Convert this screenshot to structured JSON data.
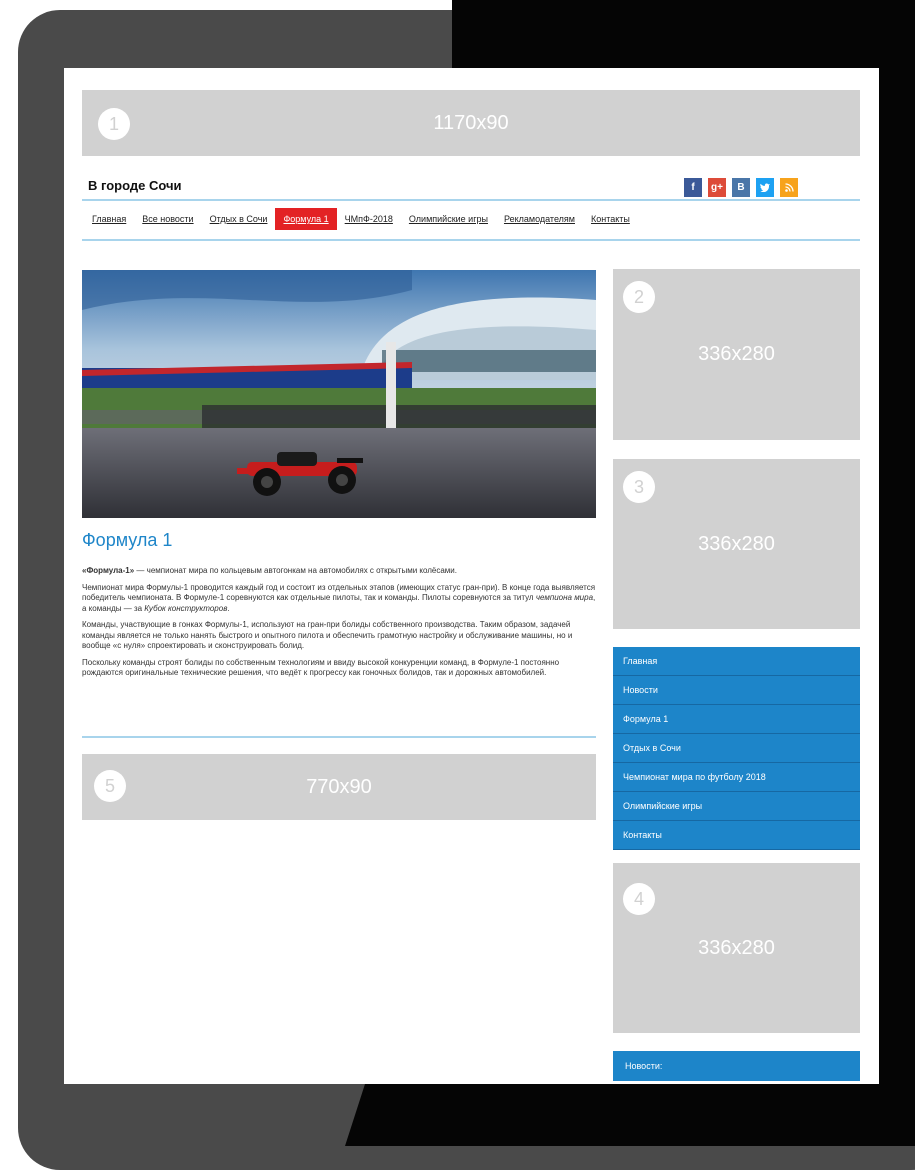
{
  "ads": {
    "top": {
      "num": "1",
      "size": "1170x90"
    },
    "side1": {
      "num": "2",
      "size": "336x280"
    },
    "side2": {
      "num": "3",
      "size": "336x280"
    },
    "side3": {
      "num": "4",
      "size": "336x280"
    },
    "bottom": {
      "num": "5",
      "size": "770x90"
    }
  },
  "header": {
    "title": "В городе Сочи",
    "social": [
      "f",
      "g+",
      "B",
      "t",
      "rss"
    ],
    "social_colors": [
      "#3b5998",
      "#dd4b39",
      "#4a76a8",
      "#1da1f2",
      "#f7a31c"
    ]
  },
  "nav": {
    "items": [
      "Главная",
      "Все новости",
      "Отдых в Сочи",
      "Формула 1",
      "ЧМпФ-2018",
      "Олимпийские игры",
      "Рекламодателям",
      "Контакты"
    ],
    "active_index": 3
  },
  "article": {
    "title": "Формула 1",
    "p1_bold": "«Формула-1»",
    "p1_rest": " — чемпионат мира по кольцевым автогонкам на автомобилях с открытыми колёсами.",
    "p2_a": "Чемпионат мира Формулы-1 проводится каждый год и состоит из отдельных этапов (имеющих статус гран-при). В конце года выявляется победитель чемпионата. В Формуле-1 соревнуются как отдельные пилоты, так и команды. Пилоты соревнуются за титул ",
    "p2_i1": "чемпиона мира",
    "p2_b": ", а команды — за ",
    "p2_i2": "Кубок конструкторов",
    "p2_c": ".",
    "p3": "Команды, участвующие в гонках Формулы-1, используют на гран-при болиды собственного производства. Таким образом, задачей команды является не только нанять быстрого и опытного пилота и обеспечить грамотную настройку и обслуживание машины, но и вообще «с нуля» спроектировать и сконструировать болид.",
    "p4": "Поскольку команды строят болиды по собственным технологиям и ввиду высокой конкуренции команд, в Формуле-1 постоянно рождаются оригинальные технические решения, что ведёт к прогрессу как гоночных болидов, так и дорожных автомобилей."
  },
  "sidebar": {
    "menu": [
      "Главная",
      "Новости",
      "Формула 1",
      "Отдых в Сочи",
      "Чемпионат мира по футболу 2018",
      "Олимпийские игры",
      "Контакты"
    ],
    "news_label": "Новости:"
  }
}
